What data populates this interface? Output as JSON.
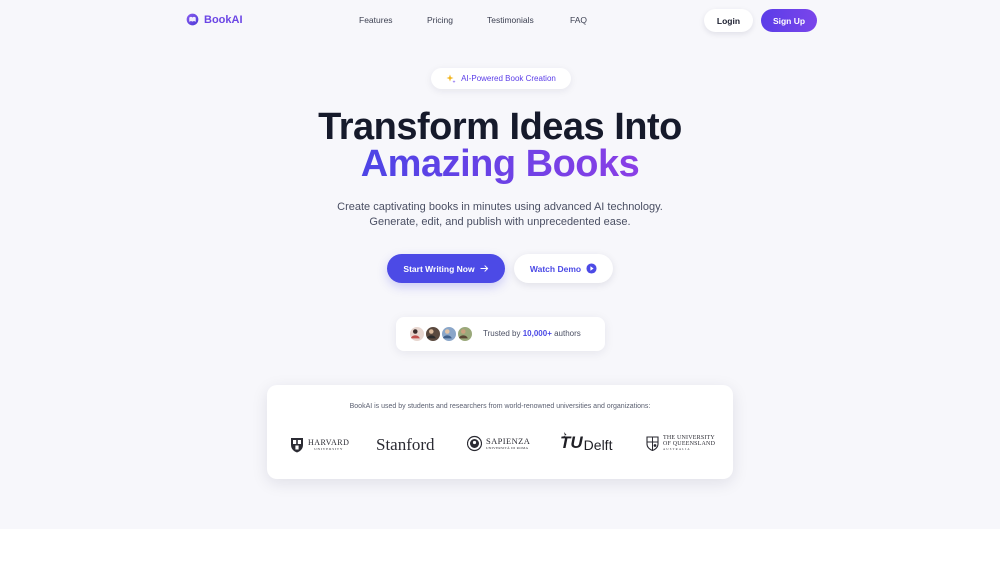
{
  "brand": {
    "name": "BookAI"
  },
  "nav": {
    "links": [
      "Features",
      "Pricing",
      "Testimonials",
      "FAQ"
    ],
    "login_label": "Login",
    "signup_label": "Sign Up"
  },
  "hero": {
    "badge": "AI-Powered Book Creation",
    "title_line1": "Transform Ideas Into",
    "title_line2": "Amazing Books",
    "subtitle_line1": "Create captivating books in minutes using advanced AI technology.",
    "subtitle_line2": "Generate, edit, and publish with unprecedented ease.",
    "cta_primary": "Start Writing Now",
    "cta_secondary": "Watch Demo"
  },
  "trust": {
    "prefix": "Trusted by",
    "count": "10,000+",
    "suffix": "authors"
  },
  "universities": {
    "caption": "BookAI is used by students and researchers from world-renowned universities and organizations:",
    "logos": [
      {
        "line1": "HARVARD",
        "line2": "UNIVERSITY"
      },
      {
        "line1": "Stanford"
      },
      {
        "line1": "SAPIENZA",
        "line2": "UNIVERSITÀ DI ROMA"
      },
      {
        "line1": "TU",
        "line2": "Delft"
      },
      {
        "line1": "THE UNIVERSITY",
        "line2": "OF QUEENSLAND",
        "line3": "AUSTRALIA"
      }
    ]
  },
  "colors": {
    "accent": "#4c4ae6",
    "brand": "#6b46e5",
    "gradient_start": "#4d44e6",
    "gradient_end": "#8a3fe6",
    "background": "#f7f7fb"
  },
  "icons": {
    "brand": "book-logo-icon",
    "badge": "sparkle-icon",
    "cta_primary": "arrow-right-icon",
    "cta_secondary": "play-circle-icon"
  }
}
